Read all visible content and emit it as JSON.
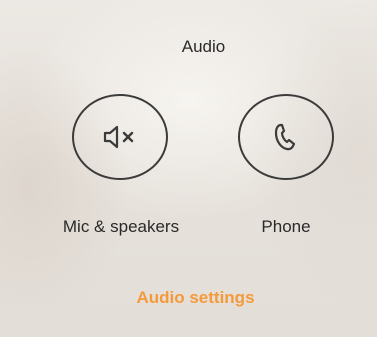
{
  "dialog": {
    "title": "Audio",
    "options": {
      "mic_speakers": {
        "label": "Mic & speakers",
        "icon": "speaker-muted-icon"
      },
      "phone": {
        "label": "Phone",
        "icon": "phone-icon"
      }
    },
    "settings_link": "Audio settings"
  },
  "colors": {
    "accent": "#f59a3a",
    "text": "#2a2a2a",
    "icon_stroke": "#3b3b3b"
  }
}
